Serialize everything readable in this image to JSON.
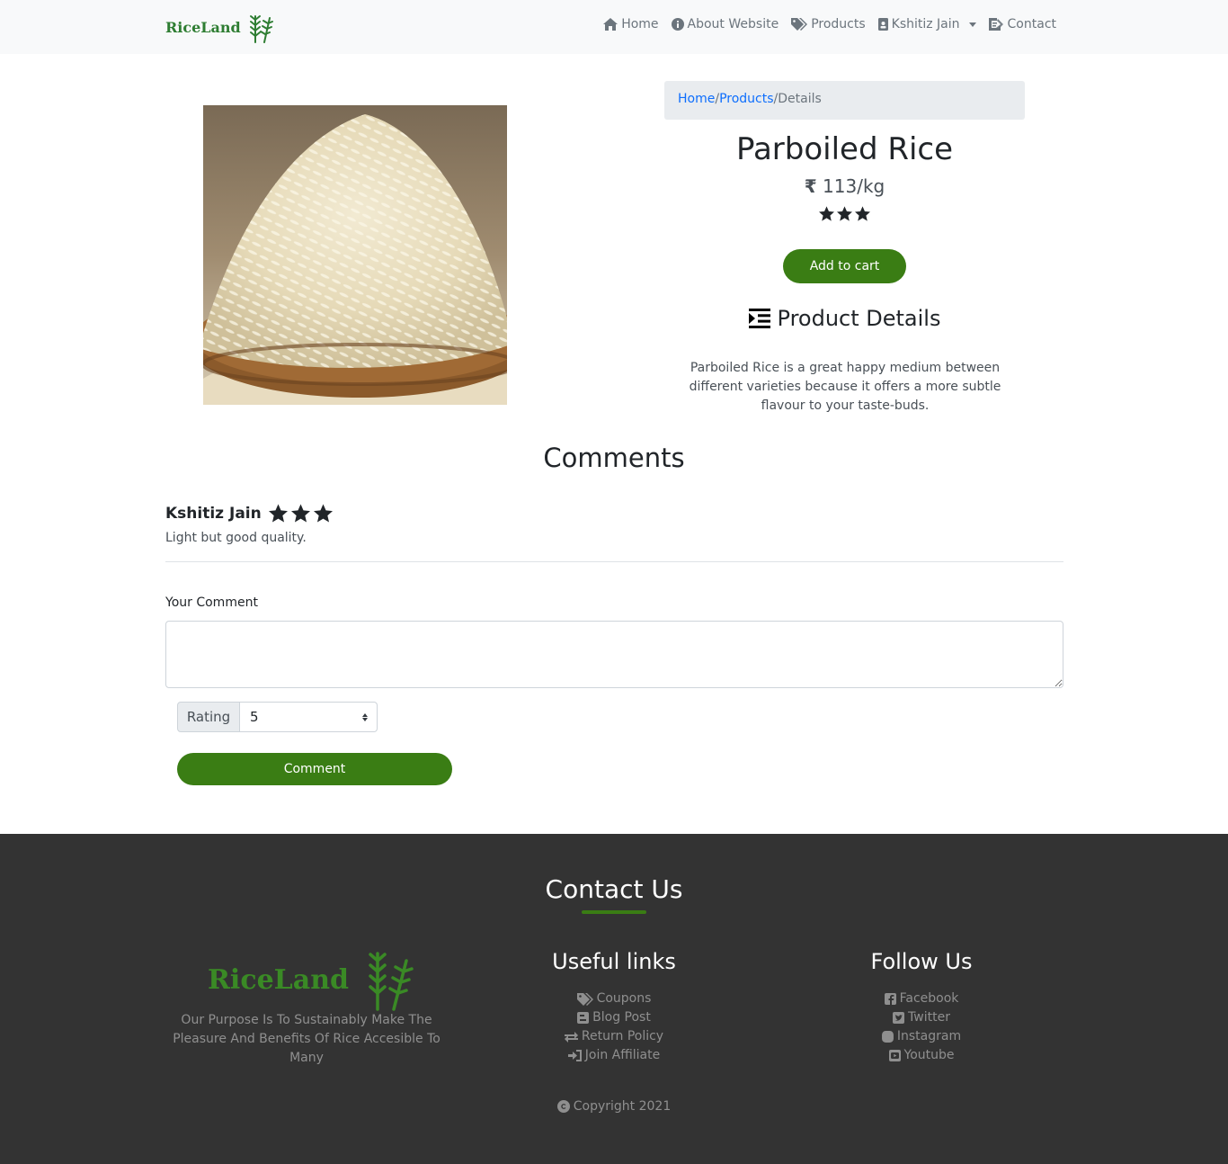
{
  "brand": {
    "name": "RiceLand"
  },
  "nav": {
    "home": "Home",
    "about": "About Website",
    "products": "Products",
    "user": "Kshitiz Jain",
    "contact": "Contact"
  },
  "breadcrumb": {
    "home": "Home",
    "products": "Products",
    "current": "Details"
  },
  "product": {
    "name": "Parboiled Rice",
    "currency_symbol": "₹",
    "price": "113/kg",
    "rating": 3,
    "add_to_cart": "Add to cart",
    "details_heading": "Product Details",
    "description": "Parboiled Rice is a great happy medium between different varieties because it offers a more subtle flavour to your taste-buds."
  },
  "comments": {
    "heading": "Comments",
    "items": [
      {
        "author": "Kshitiz Jain",
        "rating": 3,
        "text": "Light but good quality."
      }
    ],
    "form": {
      "label": "Your Comment",
      "value": "",
      "rating_label": "Rating",
      "rating_value": "5",
      "submit": "Comment"
    }
  },
  "footer": {
    "contact_heading": "Contact Us",
    "brand": "RiceLand",
    "purpose": "Our Purpose Is To Sustainably Make The Pleasure And Benefits Of Rice Accesible To Many",
    "useful_heading": "Useful links",
    "useful_links": [
      "Coupons",
      "Blog Post",
      "Return Policy",
      "Join Affiliate"
    ],
    "follow_heading": "Follow Us",
    "follow_links": [
      "Facebook",
      "Twitter",
      "Instagram",
      "Youtube"
    ],
    "copyright": "Copyright 2021"
  },
  "colors": {
    "accent": "#3a7d14",
    "brand": "#2e7d32",
    "footer_bg": "#333333"
  }
}
